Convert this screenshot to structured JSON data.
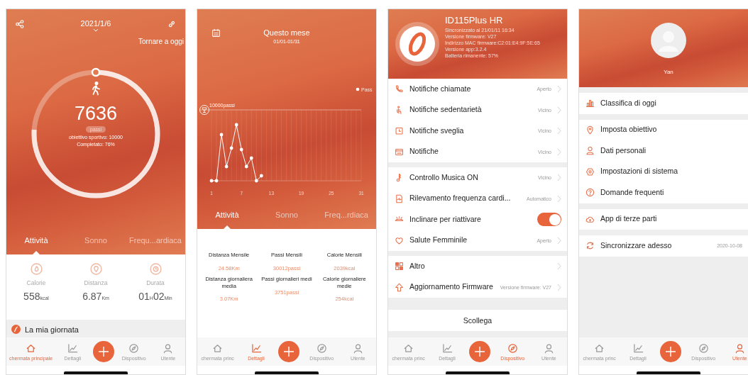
{
  "home": {
    "date": "2021/1/6",
    "back_to_today": "Tornare a oggi",
    "ring": {
      "level": 0.76,
      "steps": "7636",
      "unit": "passi",
      "goal": "obiettivo sportivo: 10000",
      "completed": "Completato: 76%"
    },
    "tabs": [
      {
        "label": "Attività",
        "selected": true
      },
      {
        "label": "Sonno",
        "selected": false
      },
      {
        "label": "Frequ...ardiaca",
        "selected": false
      }
    ],
    "stats": [
      {
        "label": "Calorie",
        "parts": [
          "558",
          "kcal"
        ]
      },
      {
        "label": "Distanza",
        "parts": [
          "6.87",
          "Km"
        ]
      },
      {
        "label": "Durata",
        "parts": [
          "01",
          "H",
          "02",
          "Min"
        ]
      }
    ],
    "section": "La mia giornata",
    "nav": [
      {
        "label": "chermata principale",
        "selected": true
      },
      {
        "label": "Dettagli",
        "selected": false
      },
      {
        "label": "Dispositivo",
        "selected": false
      },
      {
        "label": "Utente",
        "selected": false
      }
    ]
  },
  "details": {
    "title": "Questo mese",
    "range": "01/01-01/31",
    "chart": {
      "legend": "Pass",
      "goal_label": "10000passi",
      "x_ticks": [
        "1",
        "7",
        "13",
        "19",
        "25",
        "31"
      ]
    },
    "tabs": [
      {
        "label": "Attività",
        "selected": true
      },
      {
        "label": "Sonno",
        "selected": false
      },
      {
        "label": "Freq...rdiaca",
        "selected": false
      }
    ],
    "stats": [
      {
        "label": "Distanza Mensile",
        "value": "24.58Km"
      },
      {
        "label": "Passi Mensili",
        "value": "30012passi"
      },
      {
        "label": "Calorie Mensili",
        "value": "2039kcal"
      },
      {
        "label": "Distanza giornaliera media",
        "value": "3.07Km"
      },
      {
        "label": "Passi giornalieri medi",
        "value": "3751passi"
      },
      {
        "label": "Calorie giornaliere medie",
        "value": "254kcal"
      }
    ],
    "nav": [
      {
        "label": "chermata princ",
        "selected": false
      },
      {
        "label": "Dettagli",
        "selected": true
      },
      {
        "label": "Dispositivo",
        "selected": false
      },
      {
        "label": "Utente",
        "selected": false
      }
    ]
  },
  "device": {
    "name": "ID115Plus HR",
    "info": [
      "Sincronizzato al 21/01/11 16:34",
      "Versione firmware: V27",
      "Indirizzo MAC firmware:C2:01:E4:9F:5E:65",
      "Versione app:3.2.4",
      "Batteria rimanente: 57%"
    ],
    "groups": [
      [
        {
          "kind": "link",
          "label": "Notifiche chiamate",
          "value": "Aperto"
        },
        {
          "kind": "link",
          "label": "Notifiche sedentarietà",
          "value": "Vicino"
        },
        {
          "kind": "link",
          "label": "Notifiche sveglia",
          "value": "Vicino"
        },
        {
          "kind": "link",
          "label": "Notifiche",
          "value": "Vicino"
        }
      ],
      [
        {
          "kind": "link",
          "label": "Controllo Musica ON",
          "value": "Vicino"
        },
        {
          "kind": "link",
          "label": "Rilevamento frequenza cardi...",
          "value": "Automatico"
        },
        {
          "kind": "toggle",
          "label": "Inclinare per riattivare",
          "on": true
        },
        {
          "kind": "link",
          "label": "Salute Femminile",
          "value": "Aperto"
        }
      ],
      [
        {
          "kind": "link",
          "label": "Altro"
        },
        {
          "kind": "link",
          "label": "Aggiornamento Firmware",
          "value": "Versione firmware: V27"
        }
      ]
    ],
    "disconnect": "Scollega",
    "nav": [
      {
        "label": "chermata princ",
        "selected": false
      },
      {
        "label": "Dettagli",
        "selected": false
      },
      {
        "label": "Dispositivo",
        "selected": true
      },
      {
        "label": "Utente",
        "selected": false
      }
    ]
  },
  "user": {
    "name": "Yan",
    "groups": [
      [
        {
          "label": "Classifica di oggi"
        }
      ],
      [
        {
          "label": "Imposta obiettivo"
        },
        {
          "label": "Dati personali"
        },
        {
          "label": "Impostazioni di sistema"
        },
        {
          "label": "Domande frequenti"
        }
      ],
      [
        {
          "label": "App di terze parti"
        }
      ],
      [
        {
          "label": "Sincronizzare adesso",
          "value": "2020-10-08"
        }
      ]
    ],
    "nav": [
      {
        "label": "chermata princ",
        "selected": false
      },
      {
        "label": "Dettagli",
        "selected": false
      },
      {
        "label": "Dispositivo",
        "selected": false
      },
      {
        "label": "Utente",
        "selected": true
      }
    ]
  }
}
